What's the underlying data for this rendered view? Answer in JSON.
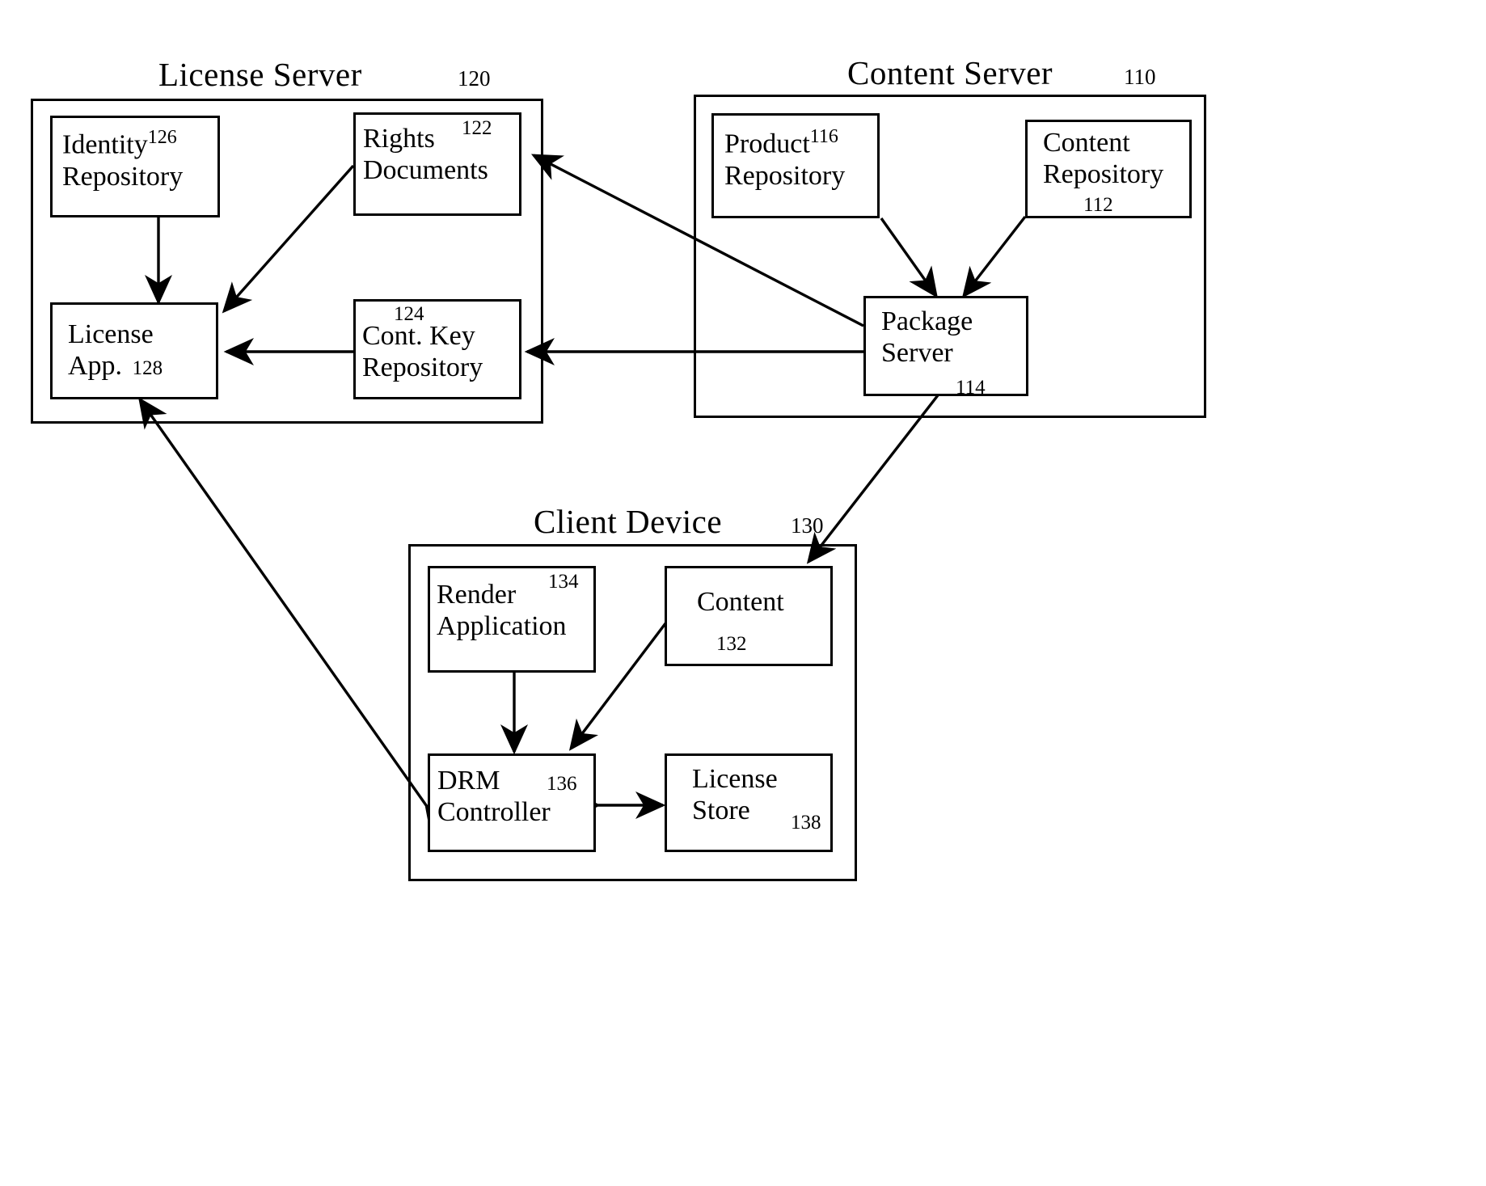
{
  "figure": {
    "type": "patent-block-diagram",
    "background": "#ffffff",
    "stroke": "#000000"
  },
  "containers": [
    {
      "id": "license-server",
      "title": "License Server",
      "ref": "120"
    },
    {
      "id": "content-server",
      "title": "Content Server",
      "ref": "110"
    },
    {
      "id": "client-device",
      "title": "Client Device",
      "ref": "130"
    }
  ],
  "nodes": {
    "identity_repository": {
      "line1": "Identity",
      "line2": "Repository",
      "ref": "126"
    },
    "rights_documents": {
      "line1": "Rights",
      "line2": "Documents",
      "ref": "122"
    },
    "license_app": {
      "line1": "License",
      "line2": "App.",
      "ref": "128"
    },
    "cont_key_repository": {
      "line1": "Cont. Key",
      "line2": "Repository",
      "ref": "124"
    },
    "product_repository": {
      "line1": "Product",
      "line2": "Repository",
      "ref": "116"
    },
    "content_repository": {
      "line1": "Content",
      "line2": "Repository",
      "ref": "112"
    },
    "package_server": {
      "line1": "Package",
      "line2": "Server",
      "ref": "114"
    },
    "render_application": {
      "line1": "Render",
      "line2": "Application",
      "ref": "134"
    },
    "content": {
      "line1": "Content",
      "line2": "",
      "ref": "132"
    },
    "drm_controller": {
      "line1": "DRM",
      "line2": "Controller",
      "ref": "136"
    },
    "license_store": {
      "line1": "License",
      "line2": "Store",
      "ref": "138"
    }
  },
  "connections": [
    {
      "from": "identity_repository",
      "to": "license_app",
      "style": "arrow-single"
    },
    {
      "from": "rights_documents",
      "to": "license_app",
      "style": "arrow-single"
    },
    {
      "from": "cont_key_repository",
      "to": "license_app",
      "style": "arrow-single"
    },
    {
      "from": "package_server",
      "to": "cont_key_repository",
      "style": "arrow-single"
    },
    {
      "from": "package_server",
      "to": "rights_documents",
      "style": "arrow-single"
    },
    {
      "from": "product_repository",
      "to": "package_server",
      "style": "arrow-single"
    },
    {
      "from": "content_repository",
      "to": "package_server",
      "style": "arrow-single"
    },
    {
      "from": "package_server",
      "to": "content",
      "style": "arrow-single"
    },
    {
      "from": "content",
      "to": "drm_controller",
      "style": "arrow-single"
    },
    {
      "from": "render_application",
      "to": "drm_controller",
      "style": "arrow-double"
    },
    {
      "from": "drm_controller",
      "to": "license_store",
      "style": "arrow-double"
    },
    {
      "from": "drm_controller",
      "to": "license_app",
      "style": "arrow-double"
    }
  ]
}
